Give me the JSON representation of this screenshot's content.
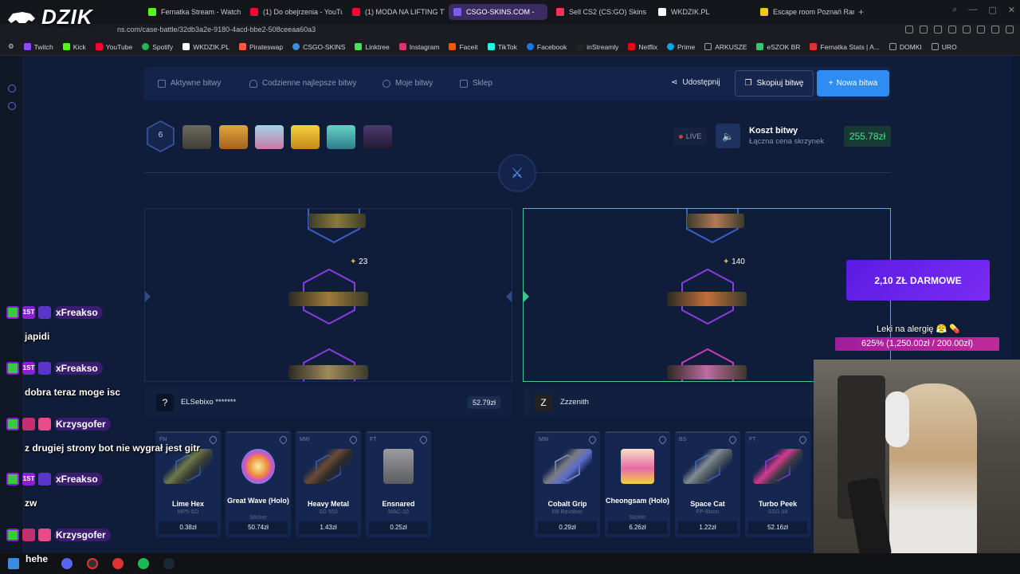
{
  "browser": {
    "logo_text": "DZIK",
    "tabs": [
      {
        "label": "Fernatka Stream - Watch",
        "color": "#53fc18"
      },
      {
        "label": "(1) Do obejrzenia - YouTu",
        "color": "#ff0033"
      },
      {
        "label": "(1) MODA NA LIFTING TW",
        "color": "#ff0033"
      },
      {
        "label": "CSGO-SKINS.COM - ",
        "color": "#7a5cff"
      },
      {
        "label": "Sell CS2 (CS:GO) Skins",
        "color": "#ff3355"
      },
      {
        "label": "WKDZIK.PL",
        "color": "#ffffff"
      },
      {
        "label": "Escape room Poznań Ran",
        "color": "#f5c518"
      }
    ],
    "url": "ns.com/case-battle/32db3a2e-9180-4acd-bbe2-508ceeaa60a3",
    "bookmarks": [
      {
        "label": "Twitch",
        "color": "#9146ff"
      },
      {
        "label": "Kick",
        "color": "#53fc18"
      },
      {
        "label": "YouTube",
        "color": "#ff0033"
      },
      {
        "label": "Spotify",
        "color": "#1db954"
      },
      {
        "label": "WKDZIK.PL",
        "color": "#ffffff"
      },
      {
        "label": "Pirateswap",
        "color": "#ff5a3c"
      },
      {
        "label": "CSGO-SKINS",
        "color": "#3a8dde"
      },
      {
        "label": "Linktree",
        "color": "#43e55e"
      },
      {
        "label": "Instagram",
        "color": "#e1306c"
      },
      {
        "label": "Faceit",
        "color": "#ff5500"
      },
      {
        "label": "TikTok",
        "color": "#25f4ee"
      },
      {
        "label": "Facebook",
        "color": "#1877f2"
      },
      {
        "label": "inStreamly",
        "color": "#222222"
      },
      {
        "label": "Netflix",
        "color": "#e50914"
      },
      {
        "label": "Prime",
        "color": "#00a8e1"
      },
      {
        "label": "ARKUSZE",
        "color": "#9aa0aa"
      },
      {
        "label": "eSZOK BR",
        "color": "#2ecc71"
      },
      {
        "label": "Fernatka Stats | A...",
        "color": "#e03030"
      },
      {
        "label": "DOMKI",
        "color": "#9aa0aa"
      },
      {
        "label": "URO",
        "color": "#9aa0aa"
      }
    ]
  },
  "nav": {
    "active_battles": "Aktywne bitwy",
    "daily_best": "Codzienne najlepsze bitwy",
    "my_battles": "Moje bitwy",
    "shop": "Sklep",
    "share": "Udostępnij",
    "copy_battle": "Skopiuj bitwę",
    "new_battle": "Nowa bitwa"
  },
  "battle": {
    "round": "6",
    "live": "LIVE",
    "cost_title": "Koszt bitwy",
    "cost_subtitle": "Łączna cena skrzynek",
    "cost_value": "255.78zł",
    "cases": [
      {
        "color": "#5b5b52"
      },
      {
        "color": "#c98a2a"
      },
      {
        "color": "#7ab0c9"
      },
      {
        "color": "#e0b026"
      },
      {
        "color": "#41a9a3"
      },
      {
        "color": "#3a2a55"
      }
    ]
  },
  "players": [
    {
      "name": "ELSebixo *******",
      "total": "52.79zł",
      "spin_count": "23",
      "avatar": "?",
      "items": [
        {
          "cond": "FN",
          "name": "Lime Hex",
          "sub": "MP5-SD",
          "price": "0.38zł",
          "color": "#6d7a4a"
        },
        {
          "cond": "",
          "name": "Great Wave (Holo)",
          "sub": "Sticker",
          "price": "50.74zł",
          "color": "#f08a3a"
        },
        {
          "cond": "MW",
          "name": "Heavy Metal",
          "sub": "SG 553",
          "price": "1.43zł",
          "color": "#6b4b35"
        },
        {
          "cond": "FT",
          "name": "Ensnared",
          "sub": "MAC-10",
          "price": "0.25zł",
          "color": "#8d8f92"
        }
      ]
    },
    {
      "name": "Zzzenith",
      "total": "",
      "spin_count": "140",
      "avatar": "Z",
      "items": [
        {
          "cond": "MW",
          "name": "Cobalt Grip",
          "sub": "R8 Revolver",
          "price": "0.29zł",
          "color": "#5b6cc9"
        },
        {
          "cond": "",
          "name": "Cheongsam (Holo)",
          "sub": "Sticker",
          "price": "6.26zł",
          "color": "#e86aa8"
        },
        {
          "cond": "BS",
          "name": "Space Cat",
          "sub": "PP-Bizon",
          "price": "1.22zł",
          "color": "#7f8c93"
        },
        {
          "cond": "FT",
          "name": "Turbo Peek",
          "sub": "SSG 08",
          "price": "52.16zł",
          "color": "#d53a8b"
        }
      ]
    }
  ],
  "overlay": {
    "promo": "2,10 ZŁ DARMOWE",
    "donation_title": "Leki na alergię 😤 💊",
    "donation_progress": "625% (1,250.00zł / 200.00zł)",
    "chat": [
      {
        "user": "xFreakso",
        "msg": "japidi"
      },
      {
        "user": "xFreakso",
        "msg": "dobra teraz moge isc"
      },
      {
        "user": "Krzysgofer",
        "msg": "z drugiej strony bot nie wygrał jest gitr"
      },
      {
        "user": "xFreakso",
        "msg": "zw"
      },
      {
        "user": "Krzysgofer",
        "msg": ""
      }
    ],
    "chat_bottom": "hehe"
  }
}
